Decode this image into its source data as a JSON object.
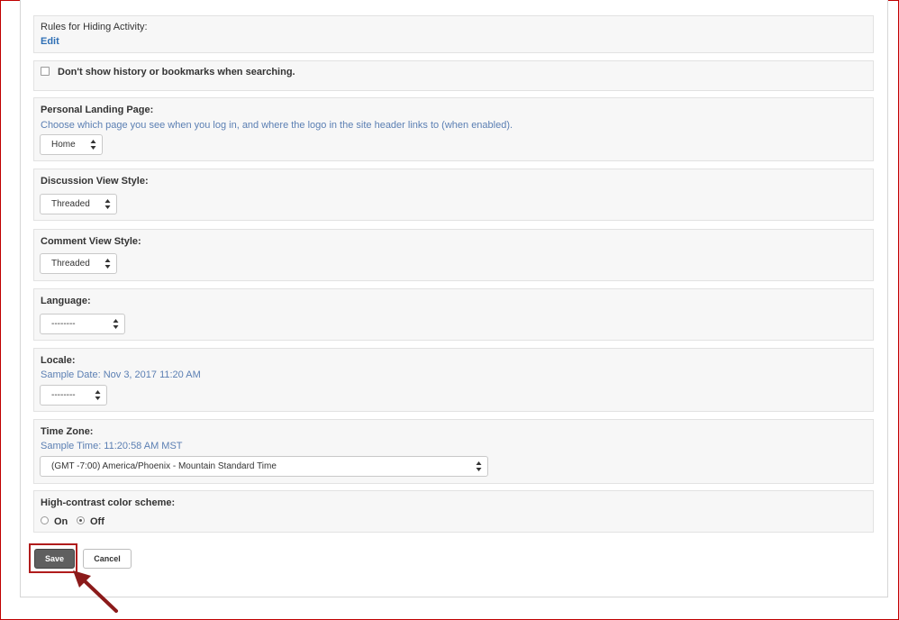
{
  "hiding": {
    "label": "Rules for Hiding Activity:",
    "edit_link": "Edit"
  },
  "search_history": {
    "label": "Don't show history or bookmarks when searching.",
    "checked": false
  },
  "landing": {
    "label": "Personal Landing Page:",
    "hint": "Choose which page you see when you log in, and where the logo in the site header links to (when enabled).",
    "value": "Home"
  },
  "discussion_view": {
    "label": "Discussion View Style:",
    "value": "Threaded"
  },
  "comment_view": {
    "label": "Comment View Style:",
    "value": "Threaded"
  },
  "language": {
    "label": "Language:",
    "value": "--------"
  },
  "locale": {
    "label": "Locale:",
    "hint": "Sample Date: Nov 3, 2017 11:20 AM",
    "value": "--------"
  },
  "timezone": {
    "label": "Time Zone:",
    "hint": "Sample Time: 11:20:58 AM MST",
    "value": "(GMT -7:00) America/Phoenix - Mountain Standard Time"
  },
  "contrast": {
    "label": "High-contrast color scheme:",
    "on_label": "On",
    "off_label": "Off",
    "selected": "Off"
  },
  "actions": {
    "save_label": "Save",
    "cancel_label": "Cancel"
  },
  "colors": {
    "link": "#2f6fb5",
    "hint": "#5b7fb3",
    "highlight": "#b01c1c",
    "arrow": "#8b1a1a"
  }
}
